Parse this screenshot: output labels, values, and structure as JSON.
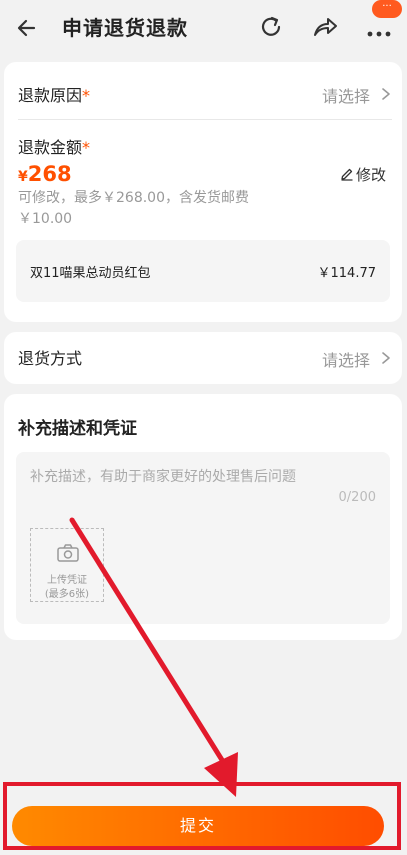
{
  "header": {
    "title": "申请退货退款",
    "badge": "···"
  },
  "refund_reason": {
    "label": "退款原因",
    "required_mark": "*",
    "placeholder": "请选择"
  },
  "refund_amount": {
    "label": "退款金额",
    "required_mark": "*",
    "currency": "¥",
    "value": "268",
    "edit_label": "修改",
    "hint": "可修改，最多￥268.00，含发货邮费￥10.00"
  },
  "red_packet": {
    "name": "双11喵果总动员红包",
    "value": "￥114.77"
  },
  "return_method": {
    "label": "退货方式",
    "placeholder": "请选择"
  },
  "supplement": {
    "title": "补充描述和凭证",
    "placeholder": "补充描述，有助于商家更好的处理售后问题",
    "count": "0/200",
    "upload_line1": "上传凭证",
    "upload_line2": "(最多6张)"
  },
  "submit_label": "提交",
  "colors": {
    "accent": "#ff5000",
    "annotation": "#e21a2c"
  },
  "icons": [
    "back-arrow-icon",
    "refresh-icon",
    "share-icon",
    "more-icon",
    "chevron-right-icon",
    "pencil-icon",
    "camera-icon"
  ]
}
